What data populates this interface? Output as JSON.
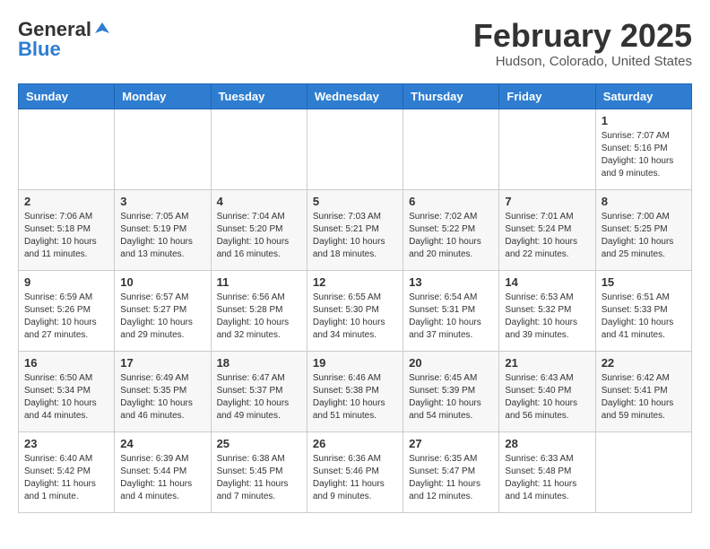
{
  "header": {
    "logo_general": "General",
    "logo_blue": "Blue",
    "month_title": "February 2025",
    "location": "Hudson, Colorado, United States"
  },
  "weekdays": [
    "Sunday",
    "Monday",
    "Tuesday",
    "Wednesday",
    "Thursday",
    "Friday",
    "Saturday"
  ],
  "weeks": [
    [
      {
        "day": "",
        "info": ""
      },
      {
        "day": "",
        "info": ""
      },
      {
        "day": "",
        "info": ""
      },
      {
        "day": "",
        "info": ""
      },
      {
        "day": "",
        "info": ""
      },
      {
        "day": "",
        "info": ""
      },
      {
        "day": "1",
        "info": "Sunrise: 7:07 AM\nSunset: 5:16 PM\nDaylight: 10 hours\nand 9 minutes."
      }
    ],
    [
      {
        "day": "2",
        "info": "Sunrise: 7:06 AM\nSunset: 5:18 PM\nDaylight: 10 hours\nand 11 minutes."
      },
      {
        "day": "3",
        "info": "Sunrise: 7:05 AM\nSunset: 5:19 PM\nDaylight: 10 hours\nand 13 minutes."
      },
      {
        "day": "4",
        "info": "Sunrise: 7:04 AM\nSunset: 5:20 PM\nDaylight: 10 hours\nand 16 minutes."
      },
      {
        "day": "5",
        "info": "Sunrise: 7:03 AM\nSunset: 5:21 PM\nDaylight: 10 hours\nand 18 minutes."
      },
      {
        "day": "6",
        "info": "Sunrise: 7:02 AM\nSunset: 5:22 PM\nDaylight: 10 hours\nand 20 minutes."
      },
      {
        "day": "7",
        "info": "Sunrise: 7:01 AM\nSunset: 5:24 PM\nDaylight: 10 hours\nand 22 minutes."
      },
      {
        "day": "8",
        "info": "Sunrise: 7:00 AM\nSunset: 5:25 PM\nDaylight: 10 hours\nand 25 minutes."
      }
    ],
    [
      {
        "day": "9",
        "info": "Sunrise: 6:59 AM\nSunset: 5:26 PM\nDaylight: 10 hours\nand 27 minutes."
      },
      {
        "day": "10",
        "info": "Sunrise: 6:57 AM\nSunset: 5:27 PM\nDaylight: 10 hours\nand 29 minutes."
      },
      {
        "day": "11",
        "info": "Sunrise: 6:56 AM\nSunset: 5:28 PM\nDaylight: 10 hours\nand 32 minutes."
      },
      {
        "day": "12",
        "info": "Sunrise: 6:55 AM\nSunset: 5:30 PM\nDaylight: 10 hours\nand 34 minutes."
      },
      {
        "day": "13",
        "info": "Sunrise: 6:54 AM\nSunset: 5:31 PM\nDaylight: 10 hours\nand 37 minutes."
      },
      {
        "day": "14",
        "info": "Sunrise: 6:53 AM\nSunset: 5:32 PM\nDaylight: 10 hours\nand 39 minutes."
      },
      {
        "day": "15",
        "info": "Sunrise: 6:51 AM\nSunset: 5:33 PM\nDaylight: 10 hours\nand 41 minutes."
      }
    ],
    [
      {
        "day": "16",
        "info": "Sunrise: 6:50 AM\nSunset: 5:34 PM\nDaylight: 10 hours\nand 44 minutes."
      },
      {
        "day": "17",
        "info": "Sunrise: 6:49 AM\nSunset: 5:35 PM\nDaylight: 10 hours\nand 46 minutes."
      },
      {
        "day": "18",
        "info": "Sunrise: 6:47 AM\nSunset: 5:37 PM\nDaylight: 10 hours\nand 49 minutes."
      },
      {
        "day": "19",
        "info": "Sunrise: 6:46 AM\nSunset: 5:38 PM\nDaylight: 10 hours\nand 51 minutes."
      },
      {
        "day": "20",
        "info": "Sunrise: 6:45 AM\nSunset: 5:39 PM\nDaylight: 10 hours\nand 54 minutes."
      },
      {
        "day": "21",
        "info": "Sunrise: 6:43 AM\nSunset: 5:40 PM\nDaylight: 10 hours\nand 56 minutes."
      },
      {
        "day": "22",
        "info": "Sunrise: 6:42 AM\nSunset: 5:41 PM\nDaylight: 10 hours\nand 59 minutes."
      }
    ],
    [
      {
        "day": "23",
        "info": "Sunrise: 6:40 AM\nSunset: 5:42 PM\nDaylight: 11 hours\nand 1 minute."
      },
      {
        "day": "24",
        "info": "Sunrise: 6:39 AM\nSunset: 5:44 PM\nDaylight: 11 hours\nand 4 minutes."
      },
      {
        "day": "25",
        "info": "Sunrise: 6:38 AM\nSunset: 5:45 PM\nDaylight: 11 hours\nand 7 minutes."
      },
      {
        "day": "26",
        "info": "Sunrise: 6:36 AM\nSunset: 5:46 PM\nDaylight: 11 hours\nand 9 minutes."
      },
      {
        "day": "27",
        "info": "Sunrise: 6:35 AM\nSunset: 5:47 PM\nDaylight: 11 hours\nand 12 minutes."
      },
      {
        "day": "28",
        "info": "Sunrise: 6:33 AM\nSunset: 5:48 PM\nDaylight: 11 hours\nand 14 minutes."
      },
      {
        "day": "",
        "info": ""
      }
    ]
  ]
}
